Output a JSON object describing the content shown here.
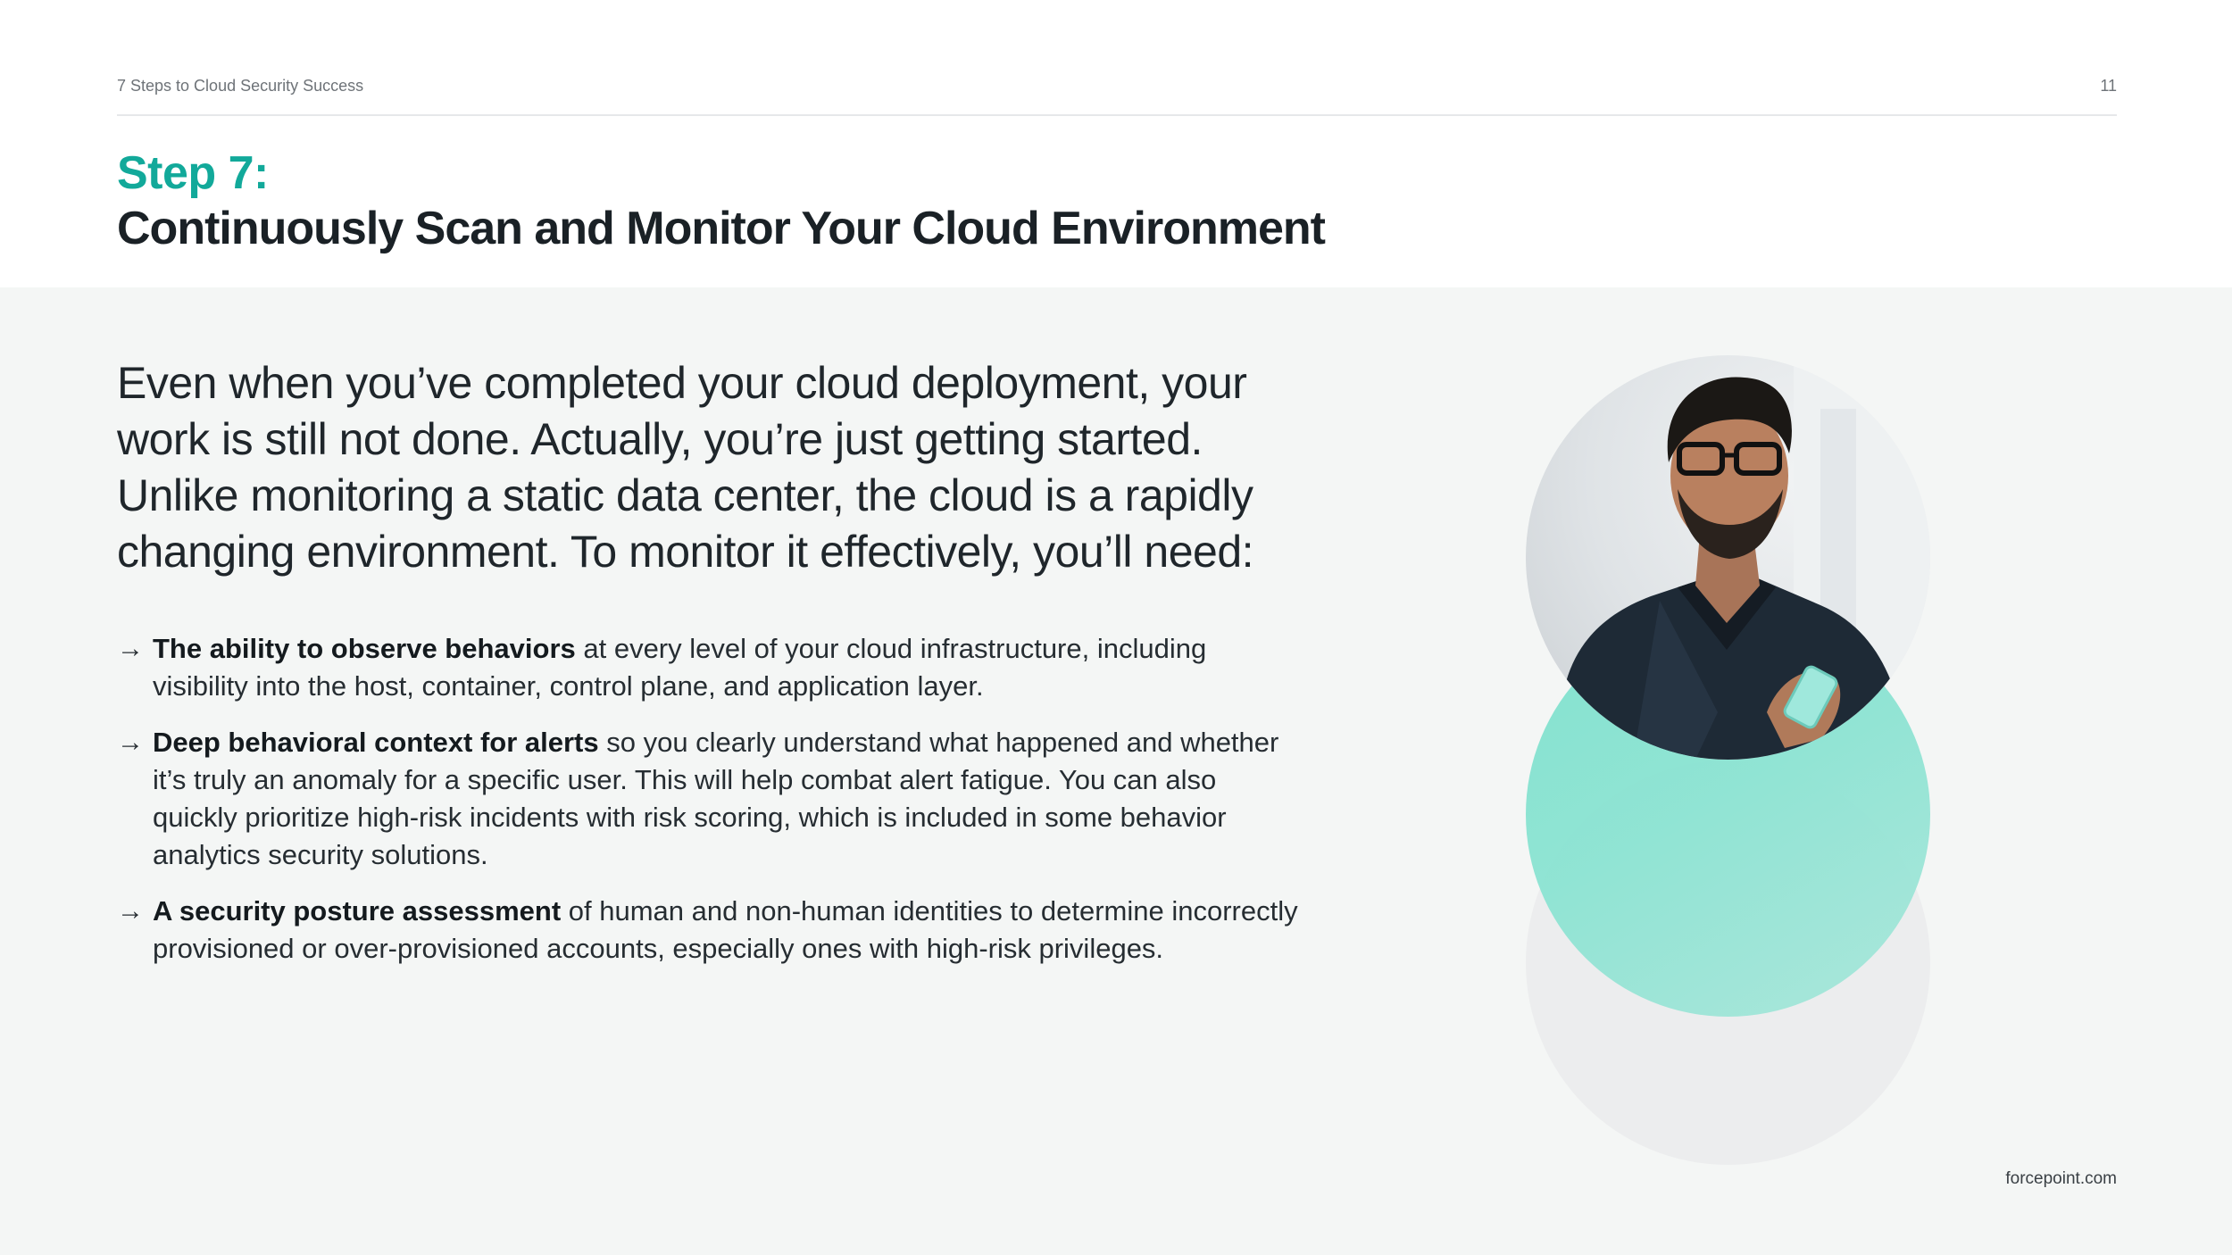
{
  "header": {
    "document_title": "7 Steps to Cloud Security Success",
    "page_number": "11"
  },
  "heading": {
    "step": "Step 7:",
    "title": "Continuously Scan and Monitor Your Cloud Environment"
  },
  "lead": "Even when you’ve completed your cloud deployment, your work is still not done. Actually, you’re just getting started. Unlike monitoring a static data center, the cloud is a rapidly changing environment. To monitor it effectively, you’ll need:",
  "bullets": [
    {
      "strong": "The ability to observe behaviors",
      "text": " at every level of your cloud infrastructure, including visibility into the host, container, control plane, and application layer."
    },
    {
      "strong": "Deep behavioral context for alerts",
      "text": " so you clearly understand what happened and whether it’s truly an anomaly for a specific user. This will help combat alert fatigue. You can also quickly prioritize high-risk incidents with risk scoring, which is included in some behavior analytics security solutions."
    },
    {
      "strong": "A security posture assessment",
      "text": " of human and non-human identities to determine incorrectly provisioned or over-provisioned accounts, especially ones with high-risk privileges."
    }
  ],
  "bullet_glyph": "→",
  "footer": {
    "site": "forcepoint.com"
  },
  "colors": {
    "accent_teal": "#12a99a",
    "circle_teal": "#8be3d2",
    "circle_grey": "#ecedee",
    "background": "#f4f6f5"
  },
  "icons": {
    "bullet": "arrow-right-icon"
  }
}
